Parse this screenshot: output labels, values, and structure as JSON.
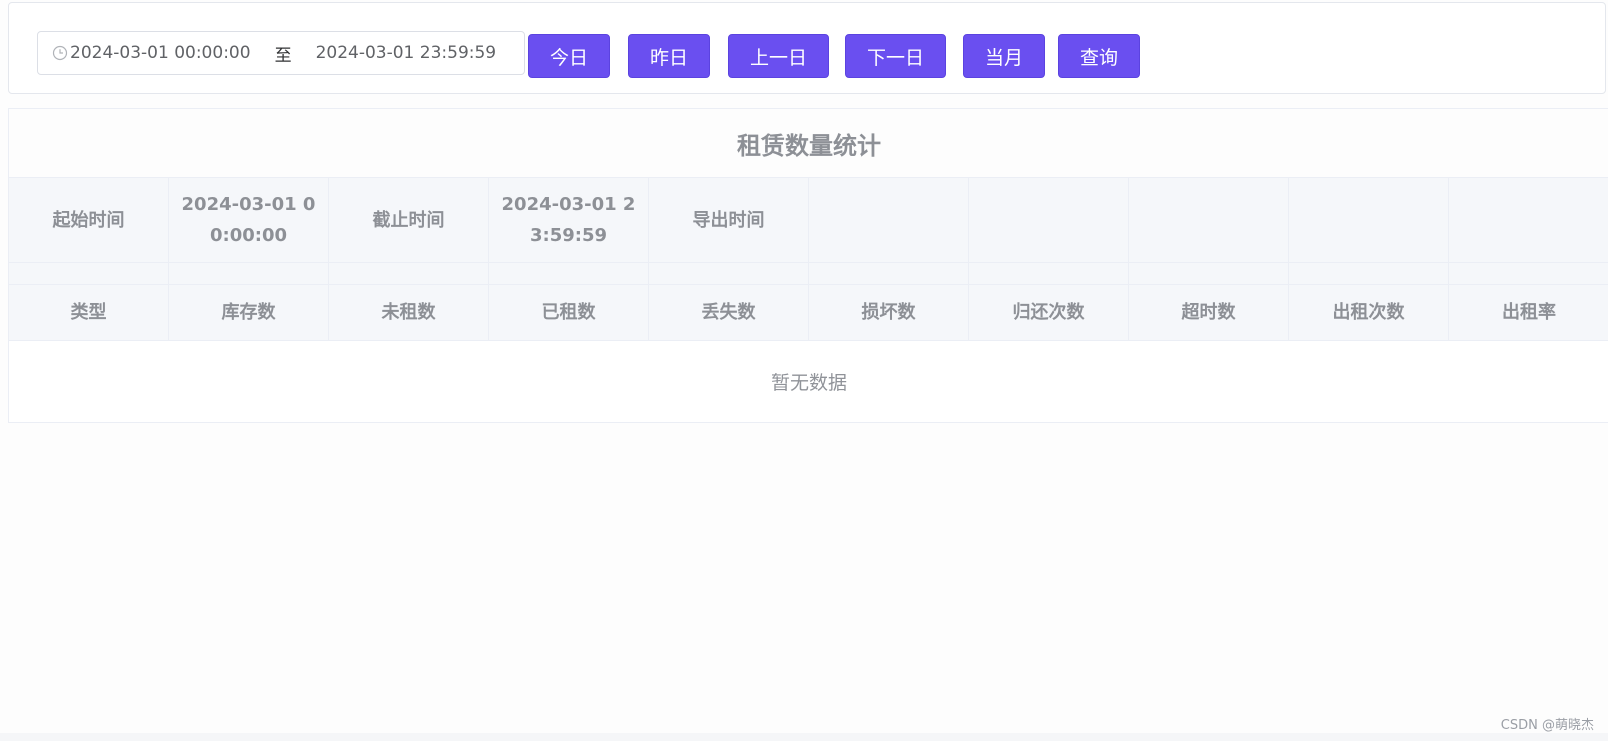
{
  "toolbar": {
    "date_range": {
      "start": "2024-03-01 00:00:00",
      "separator": "至",
      "end": "2024-03-01 23:59:59",
      "icon": "clock-icon"
    },
    "buttons": {
      "today": "今日",
      "yesterday": "昨日",
      "prev_day": "上一日",
      "next_day": "下一日",
      "this_month": "当月",
      "query": "查询"
    },
    "accent_color": "#6a4ff0"
  },
  "report": {
    "title": "租赁数量统计",
    "meta": {
      "start_label": "起始时间",
      "start_value": "2024-03-01 00:00:00",
      "end_label": "截止时间",
      "end_value": "2024-03-01 23:59:59",
      "export_label": "导出时间",
      "export_value": ""
    },
    "columns": [
      "类型",
      "库存数",
      "未租数",
      "已租数",
      "丢失数",
      "损坏数",
      "归还次数",
      "超时数",
      "出租次数",
      "出租率"
    ],
    "empty_text": "暂无数据"
  },
  "watermark": "CSDN @萌晓杰"
}
